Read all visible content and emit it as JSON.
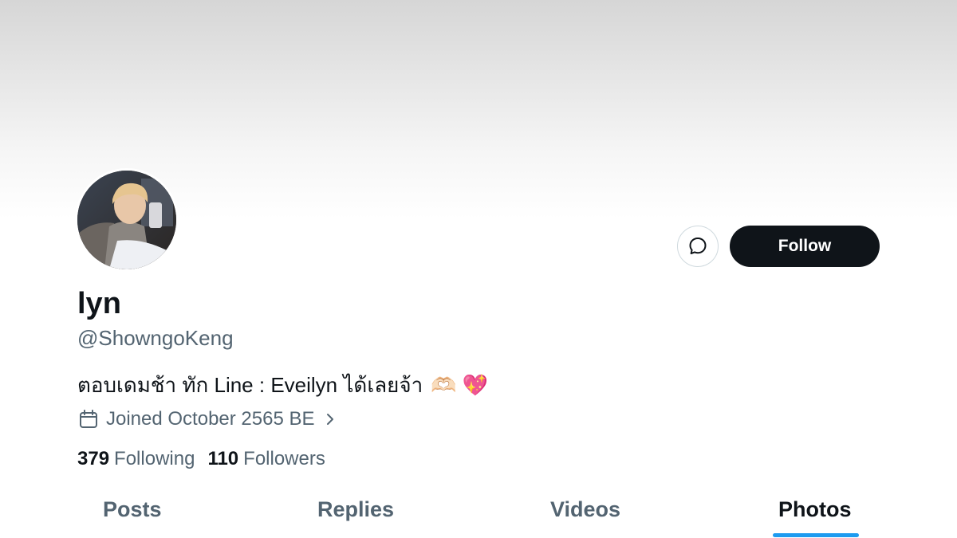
{
  "profile": {
    "display_name": "lyn",
    "handle": "@ShowngoKeng",
    "bio": "ตอบเดมช้า ทัก Line : Eveilyn ได้เลยจ้า",
    "bio_emojis": "🫶🏻 💖",
    "joined": "Joined October 2565 BE",
    "following_count": "379",
    "following_label": "Following",
    "followers_count": "110",
    "followers_label": "Followers"
  },
  "actions": {
    "message_icon": "message-icon",
    "follow_label": "Follow"
  },
  "tabs": [
    {
      "label": "Posts",
      "active": false
    },
    {
      "label": "Replies",
      "active": false
    },
    {
      "label": "Videos",
      "active": false
    },
    {
      "label": "Photos",
      "active": true
    }
  ],
  "colors": {
    "text_primary": "#0f1419",
    "text_secondary": "#536471",
    "accent": "#1d9bf0",
    "follow_button_bg": "#0f1419"
  }
}
